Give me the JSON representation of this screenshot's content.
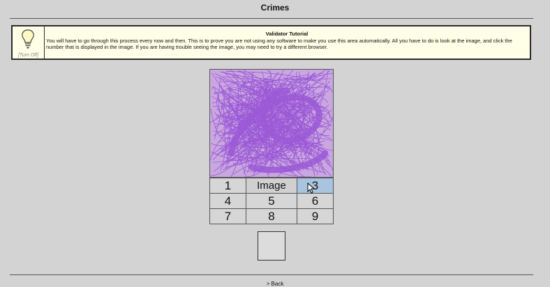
{
  "page": {
    "title": "Crimes"
  },
  "tutorial": {
    "icon": "lightbulb-icon",
    "turn_off_label": "[Turn Off]",
    "title": "Validator Tutorial",
    "text": "You will have to go through this process every now and then. This is to prove you are not using any software to make you use this area automatically. All you have to do is look at the image, and click the number that is displayed in the image. If you are having trouble seeing the image, you may need to try a different browser."
  },
  "captcha": {
    "image_color": "#9b59d6",
    "label": "Image",
    "buttons": [
      "1",
      "3",
      "4",
      "5",
      "6",
      "7",
      "8",
      "9"
    ]
  },
  "footer": {
    "back_label": "> Back"
  }
}
